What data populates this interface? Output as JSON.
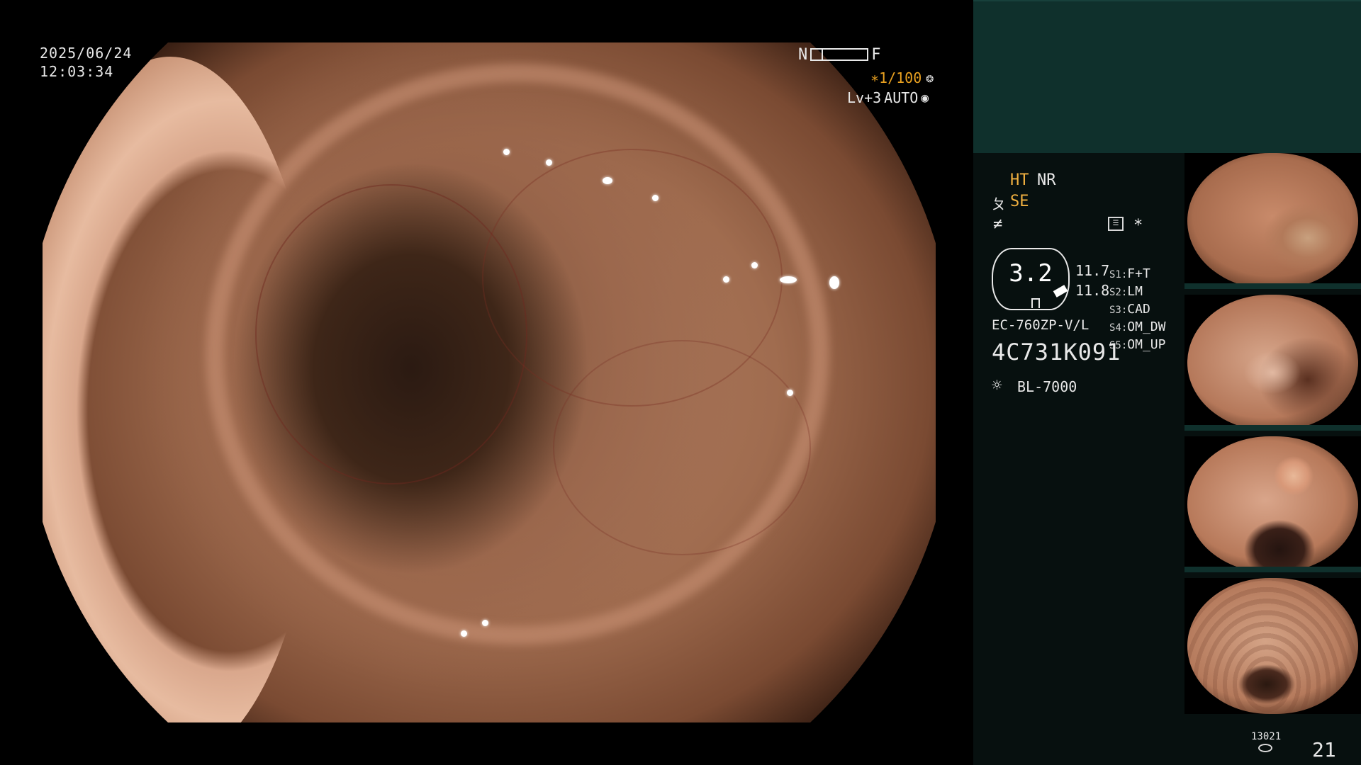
{
  "overlay": {
    "date": "2025/06/24",
    "time": "12:03:34",
    "near_label": "N",
    "far_label": "F",
    "shutter": "∗1/100",
    "shutter_icon": "aperture-icon",
    "level": "Lv+3",
    "mode": "AUTO",
    "mode_icon": "iris-icon"
  },
  "panel": {
    "ht": "HT",
    "nr": "NR",
    "se_icon": "ㄆ",
    "se": "SE",
    "f_icon": "≠",
    "star": "*",
    "gauge_value": "3.2",
    "value_top": "11.7",
    "value_bottom": "11.8",
    "switches": [
      {
        "key": "S1",
        "value": "F+T"
      },
      {
        "key": "S2",
        "value": "LM"
      },
      {
        "key": "S3",
        "value": "CAD"
      },
      {
        "key": "S4",
        "value": "OM_DW"
      },
      {
        "key": "S5",
        "value": "OM_UP"
      }
    ],
    "scope_model": "EC-760ZP-V/L",
    "scope_serial": "4C731K091",
    "light_icon": "☼",
    "light_model": "BL-7000",
    "image_count": "13021",
    "frame_number": "21"
  },
  "colors": {
    "panel_bg": "#07100f",
    "panel_header": "#0f302c",
    "accent": "#f0b040"
  }
}
